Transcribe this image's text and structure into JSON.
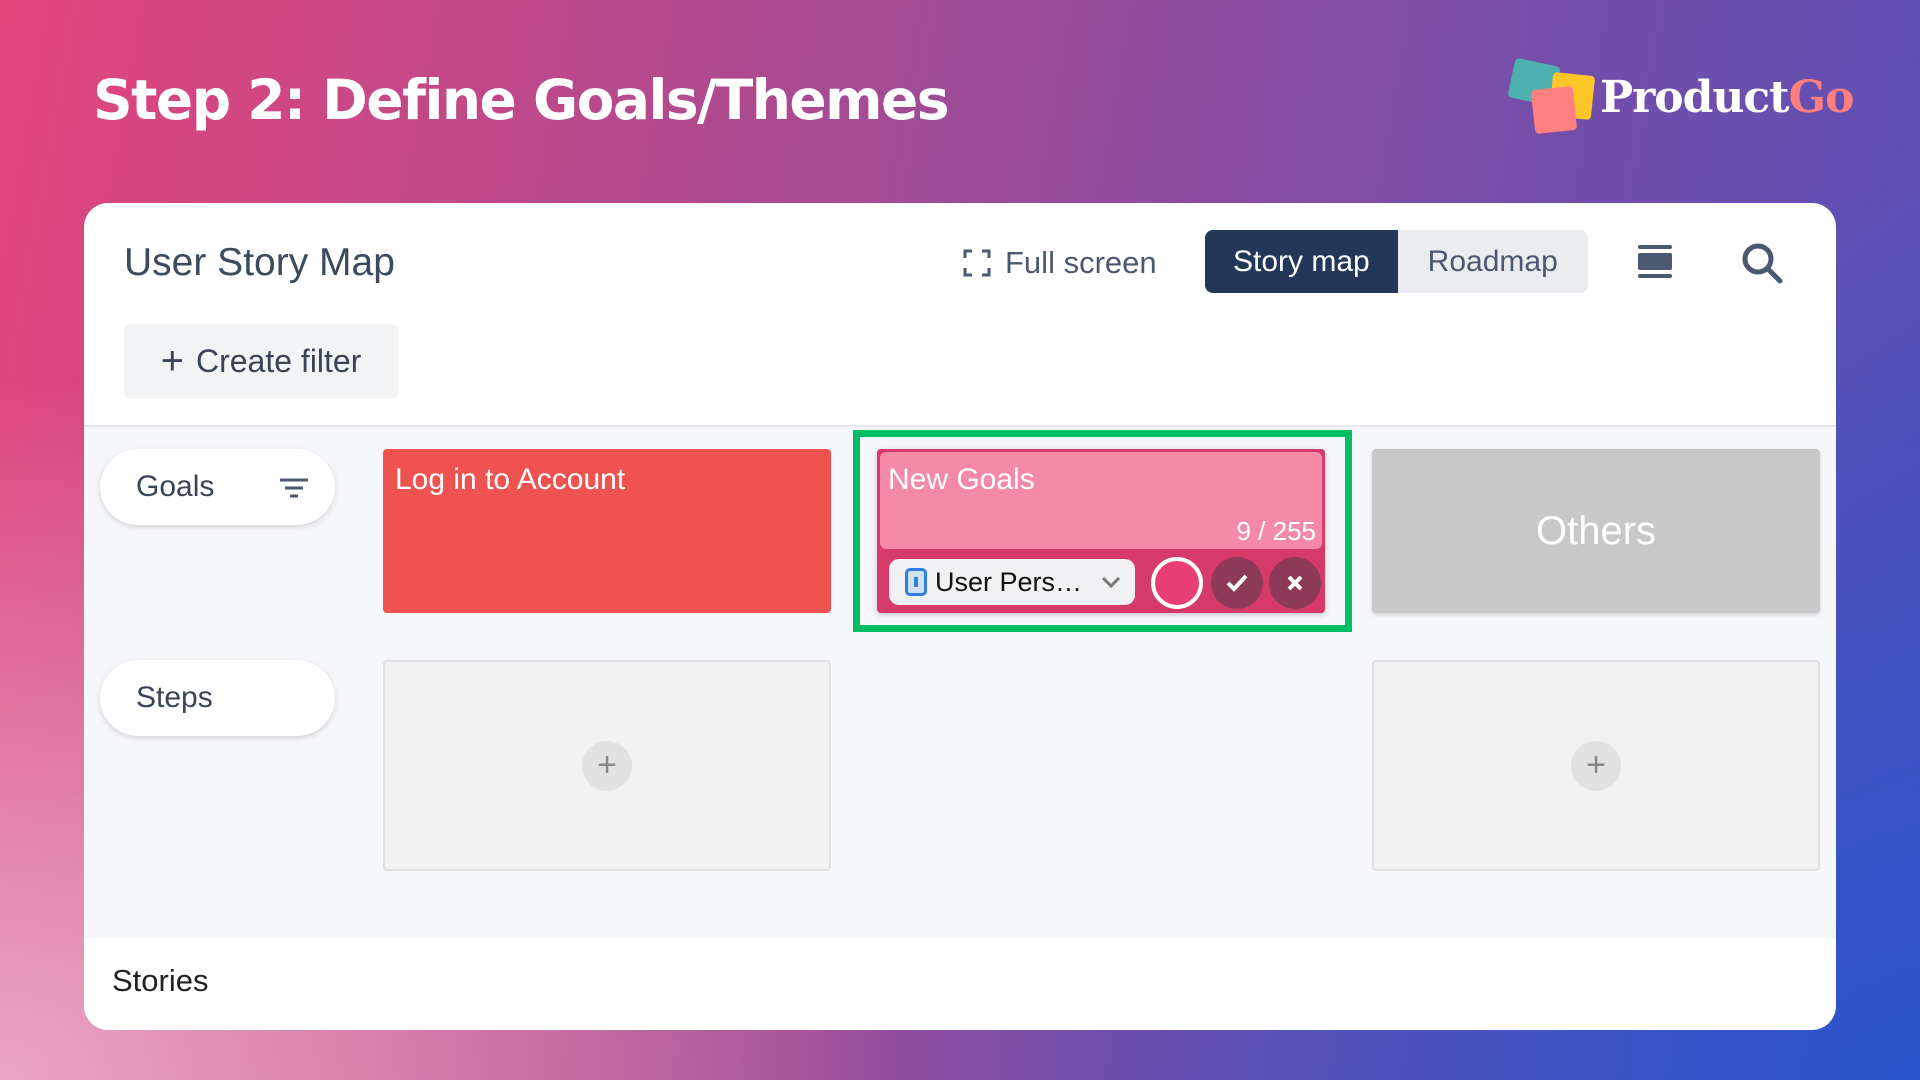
{
  "slide_title": "Step 2: Define Goals/Themes",
  "logo": {
    "text_main": "Product",
    "text_accent": "Go"
  },
  "app": {
    "title": "User Story Map",
    "full_screen_label": "Full screen",
    "view_toggle": [
      {
        "label": "Story map",
        "active": true
      },
      {
        "label": "Roadmap",
        "active": false
      }
    ],
    "create_filter_label": "Create filter",
    "rows": {
      "goals": "Goals",
      "steps": "Steps",
      "stories": "Stories"
    },
    "goal_cards": [
      {
        "title": "Log in to Account",
        "color": "#ef5350"
      },
      {
        "title": "New Goals",
        "color": "#f48aa8",
        "char_count": "9 / 255",
        "editing": true,
        "persona_select": "User Pers…"
      },
      {
        "title": "Others",
        "color": "#c8c8c8"
      }
    ],
    "add_step_labels": [
      "+",
      "+"
    ]
  },
  "colors": {
    "highlight": "#00bf63",
    "active_tab": "#233759"
  }
}
